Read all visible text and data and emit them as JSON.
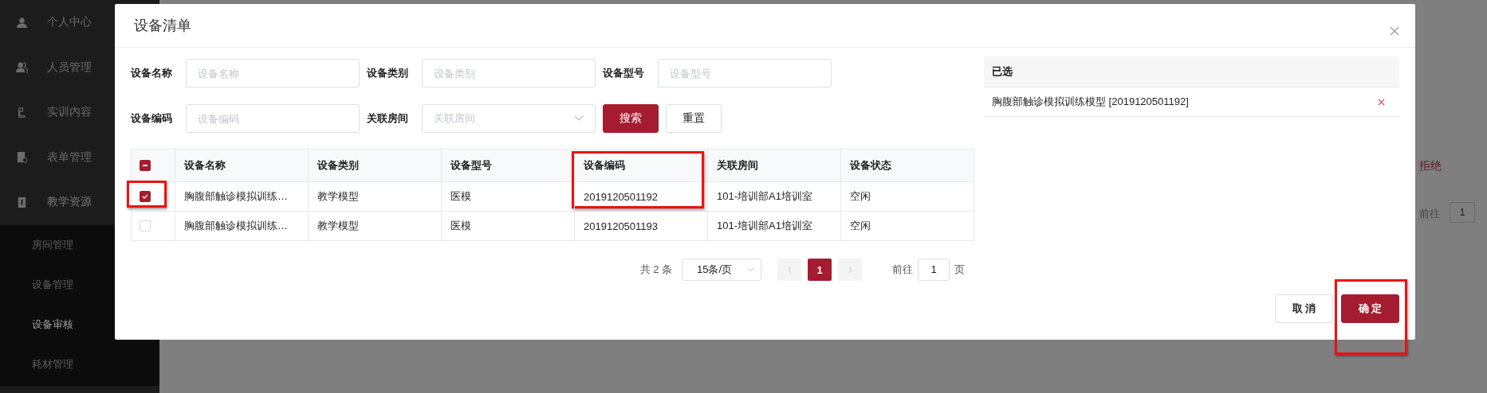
{
  "sidebar": {
    "items": [
      {
        "label": "个人中心",
        "expanded": false
      },
      {
        "label": "人员管理",
        "expanded": false
      },
      {
        "label": "实训内容",
        "expanded": false
      },
      {
        "label": "表单管理",
        "expanded": false
      },
      {
        "label": "教学资源",
        "expanded": true,
        "children": [
          {
            "label": "房间管理",
            "selected": false
          },
          {
            "label": "设备管理",
            "selected": false
          },
          {
            "label": "设备审核",
            "selected": true
          },
          {
            "label": "耗材管理",
            "selected": false
          }
        ]
      }
    ]
  },
  "background": {
    "reject_link": "拒绝",
    "goto_label": "前往",
    "goto_value": "1"
  },
  "dialog": {
    "title": "设备清单",
    "filters": [
      {
        "label": "设备名称",
        "placeholder": "设备名称",
        "kind": "text"
      },
      {
        "label": "设备类别",
        "placeholder": "设备类别",
        "kind": "text"
      },
      {
        "label": "设备型号",
        "placeholder": "设备型号",
        "kind": "text"
      },
      {
        "label": "设备编码",
        "placeholder": "设备编码",
        "kind": "text"
      },
      {
        "label": "关联房间",
        "placeholder": "关联房间",
        "kind": "select"
      }
    ],
    "search_button": "搜索",
    "reset_button": "重置",
    "table": {
      "indeterminate": true,
      "columns": [
        {
          "label": "设备名称",
          "highlighted": false
        },
        {
          "label": "设备类别",
          "highlighted": false
        },
        {
          "label": "设备型号",
          "highlighted": false
        },
        {
          "label": "设备编码",
          "highlighted": true
        },
        {
          "label": "关联房间",
          "highlighted": false
        },
        {
          "label": "设备状态",
          "highlighted": false
        }
      ],
      "rows": [
        {
          "checked": true,
          "highlighted": true,
          "cells": [
            "胸腹部触诊模拟训练…",
            "教学模型",
            "医模",
            "2019120501192",
            "101-培训部A1培训室",
            "空闲"
          ]
        },
        {
          "checked": false,
          "highlighted": false,
          "cells": [
            "胸腹部触诊模拟训练…",
            "教学模型",
            "医模",
            "2019120501193",
            "101-培训部A1培训室",
            "空闲"
          ]
        }
      ]
    },
    "pagination": {
      "total": "共 2 条",
      "page_size": "15条/页",
      "pages": [
        {
          "label": "1",
          "selected": true
        }
      ],
      "goto_label": "前往",
      "goto_value": "1",
      "goto_suffix": "页"
    },
    "selected_panel": {
      "title": "已选",
      "items": [
        "胸腹部触诊模拟训练模型 [2019120501192]"
      ]
    },
    "cancel_button": {
      "label": "取 消",
      "highlighted": false
    },
    "confirm_button": {
      "label": "确 定",
      "highlighted": true
    }
  }
}
